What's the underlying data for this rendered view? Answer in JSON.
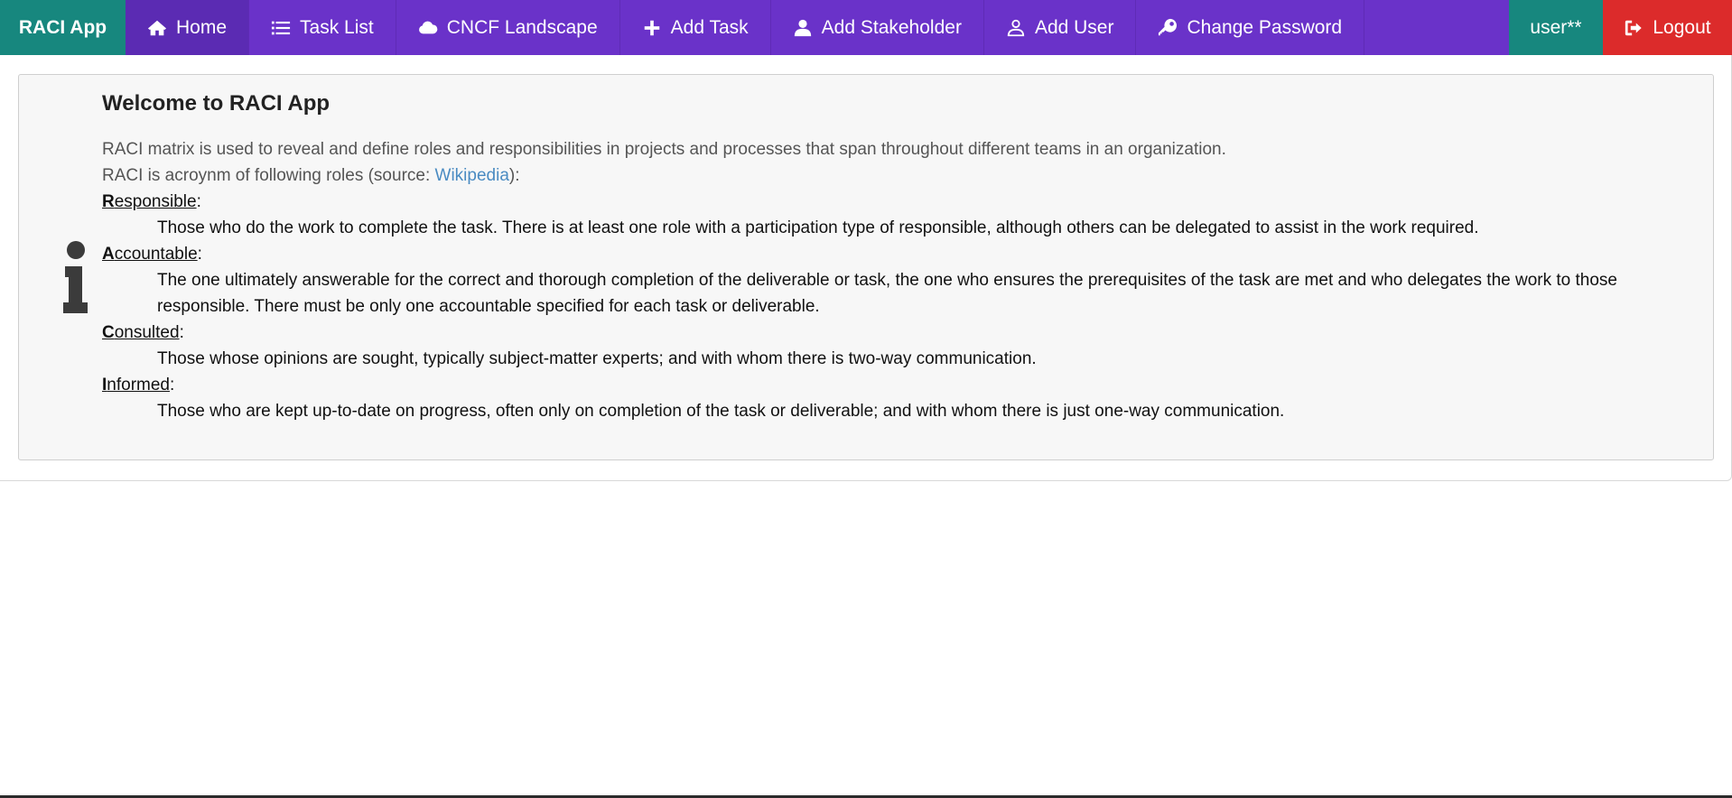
{
  "navbar": {
    "brand": "RACI App",
    "items": [
      {
        "label": "Home",
        "icon": "home-icon",
        "active": true
      },
      {
        "label": "Task List",
        "icon": "list-icon",
        "active": false
      },
      {
        "label": "CNCF Landscape",
        "icon": "cloud-icon",
        "active": false
      },
      {
        "label": "Add Task",
        "icon": "plus-icon",
        "active": false
      },
      {
        "label": "Add Stakeholder",
        "icon": "user-icon",
        "active": false
      },
      {
        "label": "Add User",
        "icon": "user-outline-icon",
        "active": false
      },
      {
        "label": "Change Password",
        "icon": "key-icon",
        "active": false
      }
    ],
    "user": "user**",
    "logout": "Logout",
    "colors": {
      "nav_bg": "#6a32c9",
      "brand_bg": "#17877e",
      "user_bg": "#17877e",
      "logout_bg": "#dc2b2b"
    }
  },
  "info": {
    "title": "Welcome to RACI App",
    "intro_line1": "RACI matrix is used to reveal and define roles and responsibilities in projects and processes that span throughout different teams in an organization.",
    "intro_line2_prefix": "RACI is acroynm of following roles (source: ",
    "intro_link": "Wikipedia",
    "intro_line2_suffix": "):",
    "roles": [
      {
        "initial": "R",
        "rest": "esponsible",
        "desc": "Those who do the work to complete the task. There is at least one role with a participation type of responsible, although others can be delegated to assist in the work required."
      },
      {
        "initial": "A",
        "rest": "ccountable",
        "desc": "The one ultimately answerable for the correct and thorough completion of the deliverable or task, the one who ensures the prerequisites of the task are met and who delegates the work to those responsible. There must be only one accountable specified for each task or deliverable."
      },
      {
        "initial": "C",
        "rest": "onsulted",
        "desc": "Those whose opinions are sought, typically subject-matter experts; and with whom there is two-way communication."
      },
      {
        "initial": "I",
        "rest": "nformed",
        "desc": "Those who are kept up-to-date on progress, often only on completion of the task or deliverable; and with whom there is just one-way communication."
      }
    ],
    "colon": ":"
  }
}
